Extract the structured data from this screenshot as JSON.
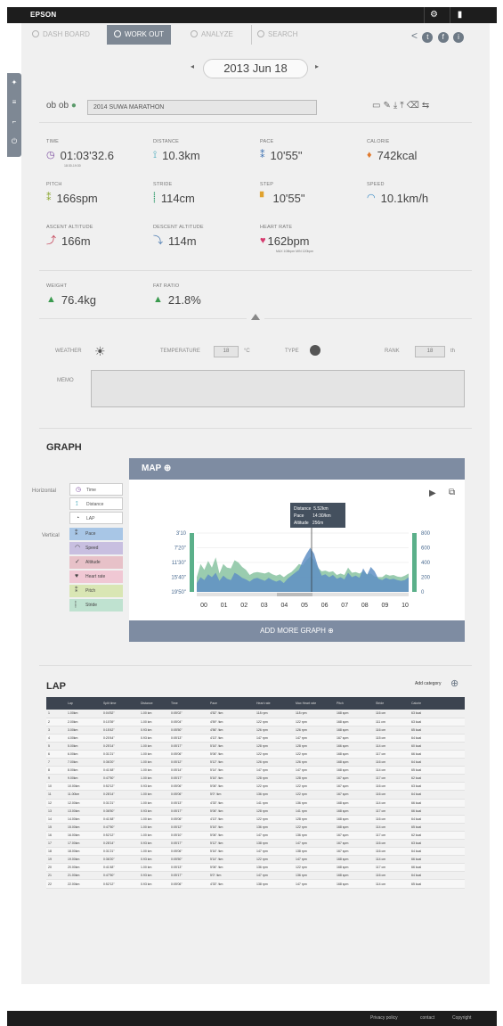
{
  "header": {
    "logo": "EPSON"
  },
  "nav": {
    "tabs": [
      {
        "label": "DASH BOARD",
        "active": false
      },
      {
        "label": "WORK OUT",
        "active": true
      },
      {
        "label": "ANALYZE",
        "active": false
      },
      {
        "label": "SEARCH",
        "active": false
      }
    ]
  },
  "date": {
    "label": "2013 Jun 18",
    "prev": "◂",
    "next": "▸"
  },
  "workout": {
    "name": "2014 SUWA MARATHON"
  },
  "stats": {
    "time": {
      "label": "TIME",
      "value": "01:03'32.6",
      "sub": "18:30-19:30"
    },
    "distance": {
      "label": "DISTANCE",
      "value": "10.3km"
    },
    "pace": {
      "label": "PACE",
      "value": "10'55\""
    },
    "calorie": {
      "label": "CALORIE",
      "value": "742kcal"
    },
    "pitch": {
      "label": "PITCH",
      "value": "166spm"
    },
    "stride": {
      "label": "STRIDE",
      "value": "114cm"
    },
    "step": {
      "label": "STEP",
      "value": "10'55\""
    },
    "speed": {
      "label": "SPEED",
      "value": "10.1km/h"
    },
    "ascent": {
      "label": "ASCENT ALTITUDE",
      "value": "166m"
    },
    "descent": {
      "label": "DESCENT ALTITUDE",
      "value": "114m"
    },
    "heart": {
      "label": "HEART RATE",
      "value": "162bpm",
      "sub": "MAX 108bpm   MIN 120bpm"
    },
    "weight": {
      "label": "WEIGHT",
      "value": "76.4kg"
    },
    "fat": {
      "label": "FAT RATIO",
      "value": "21.8%"
    }
  },
  "conditions": {
    "weather_label": "WEATHER",
    "temperature_label": "TEMPERATURE",
    "temperature_value": "18",
    "temperature_unit": "°C",
    "type_label": "TYPE",
    "rank_label": "RANK",
    "rank_value": "18",
    "rank_unit": "th",
    "memo_label": "MEMO"
  },
  "graph": {
    "title": "GRAPH",
    "map_label": "MAP",
    "add_more": "ADD MORE GRAPH",
    "horizontal_label": "Horizontal",
    "vertical_label": "Vertical",
    "horizontal_options": [
      "Time",
      "Distance",
      "LAP"
    ],
    "vertical_options": [
      {
        "label": "Pace",
        "color": "#a8c6e6",
        "icon": "pace-icon"
      },
      {
        "label": "Speed",
        "color": "#c8bfe0",
        "icon": "speed-icon"
      },
      {
        "label": "Altitude",
        "color": "#e7c1c8",
        "icon": "altitude-icon"
      },
      {
        "label": "Heart rate",
        "color": "#f0c8d4",
        "icon": "heart-icon"
      },
      {
        "label": "Pitch",
        "color": "#d9e6b4",
        "icon": "pitch-icon"
      },
      {
        "label": "Stride",
        "color": "#bfe2d0",
        "icon": "stride-icon"
      }
    ],
    "tooltip": "Distance  5.52km\nPace       14:30/km\nAltitude   256m"
  },
  "chart_data": {
    "type": "area",
    "x_ticks": [
      "00",
      "01",
      "02",
      "03",
      "04",
      "05",
      "06",
      "07",
      "08",
      "09",
      "10"
    ],
    "y_left_ticks": [
      "3'10",
      "7'20\"",
      "11'30\"",
      "15'40\"",
      "19'50\""
    ],
    "y_right_ticks": [
      "800",
      "600",
      "400",
      "200",
      "0"
    ],
    "series": [
      {
        "color": "#8fc6a6",
        "values": [
          200,
          380,
          300,
          420,
          330,
          470,
          250,
          380,
          330,
          320,
          430,
          400,
          340,
          300,
          230,
          260,
          270,
          260,
          250,
          270,
          240,
          220,
          240,
          200,
          240,
          270,
          320,
          380,
          360,
          430,
          480,
          430,
          330,
          280,
          290,
          270,
          280,
          230,
          250,
          230,
          330,
          260,
          270,
          250,
          280,
          240,
          250,
          210,
          200,
          200,
          240,
          220,
          230,
          210,
          200,
          220,
          250
        ]
      },
      {
        "color": "#5f8fc4",
        "values": [
          120,
          200,
          160,
          240,
          200,
          260,
          150,
          220,
          180,
          160,
          260,
          230,
          190,
          170,
          140,
          180,
          190,
          170,
          150,
          190,
          160,
          140,
          160,
          120,
          180,
          220,
          260,
          300,
          420,
          520,
          600,
          520,
          350,
          220,
          240,
          200,
          230,
          180,
          200,
          170,
          260,
          200,
          220,
          190,
          320,
          230,
          340,
          280,
          180,
          160,
          190,
          170,
          180,
          160,
          150,
          160,
          200
        ]
      }
    ],
    "y_right_range": [
      0,
      800
    ]
  },
  "lap": {
    "title": "LAP",
    "add_category": "Add category",
    "columns": [
      "",
      "Lap",
      "Split time",
      "Distance",
      "Time",
      "Pace",
      "Heart rate",
      "Max Heart rate",
      "Pitch",
      "Stride",
      "Calorie"
    ],
    "rows": [
      [
        "1",
        "1.00km",
        "0:04'52\"",
        "1.00 km",
        "0:05'02\"",
        "4'52\" /km",
        "118 rpm",
        "118 rpm",
        "168 spm",
        "116 cm",
        "63 kcal"
      ],
      [
        "2",
        "2.00km",
        "0:10'39\"",
        "1.00 km",
        "0:05'04\"",
        "4'59\" /km",
        "122 rpm",
        "122 rpm",
        "168 spm",
        "111 cm",
        "63 kcal"
      ],
      [
        "3",
        "3.00km",
        "0:15'42\"",
        "0.93 km",
        "0:05'50\"",
        "4'56\" /km",
        "126 rpm",
        "126 rpm",
        "168 spm",
        "116 cm",
        "65 kcal"
      ],
      [
        "4",
        "4.00km",
        "0:20'44\"",
        "0.93 km",
        "0:05'13\"",
        "4'13\" /km",
        "147 rpm",
        "147 rpm",
        "167 spm",
        "115 cm",
        "64 kcal"
      ],
      [
        "5",
        "5.00km",
        "0:25'14\"",
        "1.00 km",
        "0:05'17\"",
        "5'16\" /km",
        "128 rpm",
        "128 rpm",
        "166 spm",
        "114 cm",
        "60 kcal"
      ],
      [
        "6",
        "6.00km",
        "0:31'21\"",
        "1.00 km",
        "0:05'06\"",
        "5'06\" /km",
        "122 rpm",
        "122 rpm",
        "168 spm",
        "117 cm",
        "66 kcal"
      ],
      [
        "7",
        "7.00km",
        "0:36'20\"",
        "1.00 km",
        "0:05'12\"",
        "5'12\" /km",
        "126 rpm",
        "126 rpm",
        "168 spm",
        "116 cm",
        "64 kcal"
      ],
      [
        "8",
        "8.00km",
        "0:41'48\"",
        "1.00 km",
        "0:05'14\"",
        "5'14\" /km",
        "147 rpm",
        "147 rpm",
        "168 spm",
        "114 cm",
        "65 kcal"
      ],
      [
        "9",
        "9.00km",
        "0:47'50\"",
        "1.00 km",
        "0:05'17\"",
        "5'16\" /km",
        "128 rpm",
        "128 rpm",
        "167 spm",
        "117 cm",
        "62 kcal"
      ],
      [
        "10",
        "10.00km",
        "0:52'12\"",
        "0.93 km",
        "0:05'06\"",
        "5'06\" /km",
        "122 rpm",
        "122 rpm",
        "167 spm",
        "116 cm",
        "63 kcal"
      ],
      [
        "11",
        "11.00km",
        "0:28'14\"",
        "1.00 km",
        "0:05'06\"",
        "5'0\" /km",
        "136 rpm",
        "122 rpm",
        "167 spm",
        "116 cm",
        "64 kcal"
      ],
      [
        "12",
        "12.00km",
        "0:31'21\"",
        "1.00 km",
        "0:05'13\"",
        "4'33\" /km",
        "141 rpm",
        "136 rpm",
        "168 spm",
        "114 cm",
        "66 kcal"
      ],
      [
        "13",
        "13.00km",
        "0:36'50\"",
        "0.93 km",
        "0:05'17\"",
        "5'06\" /km",
        "128 rpm",
        "141 rpm",
        "168 spm",
        "117 cm",
        "66 kcal"
      ],
      [
        "14",
        "14.00km",
        "0:41'48\"",
        "1.00 km",
        "0:05'06\"",
        "4'13\" /km",
        "122 rpm",
        "128 rpm",
        "168 spm",
        "116 cm",
        "64 kcal"
      ],
      [
        "15",
        "15.00km",
        "0:47'50\"",
        "1.00 km",
        "0:05'12\"",
        "5'16\" /km",
        "136 rpm",
        "122 rpm",
        "168 spm",
        "114 cm",
        "65 kcal"
      ],
      [
        "16",
        "16.00km",
        "0:52'12\"",
        "1.00 km",
        "0:05'10\"",
        "5'06\" /km",
        "147 rpm",
        "136 rpm",
        "167 spm",
        "117 cm",
        "62 kcal"
      ],
      [
        "17",
        "17.00km",
        "0:28'14\"",
        "0.93 km",
        "0:05'17\"",
        "5'12\" /km",
        "138 rpm",
        "147 rpm",
        "167 spm",
        "116 cm",
        "63 kcal"
      ],
      [
        "18",
        "18.00km",
        "0:31'21\"",
        "1.00 km",
        "0:05'06\"",
        "5'16\" /km",
        "147 rpm",
        "138 rpm",
        "167 spm",
        "116 cm",
        "64 kcal"
      ],
      [
        "19",
        "19.00km",
        "0:36'20\"",
        "0.93 km",
        "0:05'50\"",
        "5'14\" /km",
        "122 rpm",
        "147 rpm",
        "168 spm",
        "114 cm",
        "66 kcal"
      ],
      [
        "20",
        "20.00km",
        "0:41'48\"",
        "1.00 km",
        "0:05'13\"",
        "5'06\" /km",
        "136 rpm",
        "122 rpm",
        "168 spm",
        "117 cm",
        "66 kcal"
      ],
      [
        "21",
        "21.00km",
        "0:47'50\"",
        "0.93 km",
        "0:05'17\"",
        "5'0\" /km",
        "147 rpm",
        "136 rpm",
        "168 spm",
        "116 cm",
        "64 kcal"
      ],
      [
        "22",
        "22.00km",
        "0:52'12\"",
        "0.93 km",
        "0:05'06\"",
        "4'33\" /km",
        "138 rpm",
        "147 rpm",
        "168 spm",
        "114 cm",
        "65 kcal"
      ]
    ]
  },
  "footer": {
    "privacy": "Privacy policy",
    "contact": "contact",
    "copyright": "Copyright"
  }
}
